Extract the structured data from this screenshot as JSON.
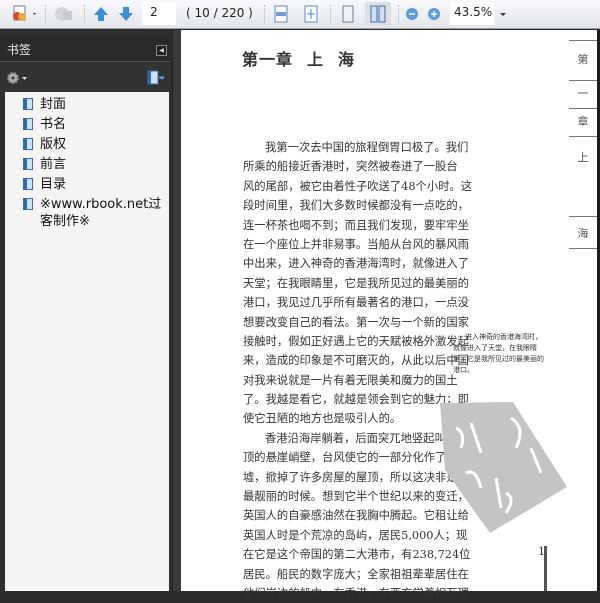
{
  "toolbar": {
    "page_number": "2",
    "page_count": "( 10 / 220 )",
    "zoom": "43.5%"
  },
  "sidebar": {
    "title": "书签",
    "bookmarks": [
      "封面",
      "书名",
      "版权",
      "前言",
      "目录",
      "※www.rbook.net过客制作※"
    ]
  },
  "document": {
    "chapter_title": [
      "第一章",
      "上",
      "海"
    ],
    "paragraphs": [
      [
        "我第一次去中国的旅程倒胃口极了。我们",
        "所乘的船接近香港时，突然被卷进了一股台",
        "风的尾部，被它由着性子吹送了48个小时。这",
        "段时间里，我们大多数时候都没有一点吃的，",
        "连一杯茶也喝不到；而且我们发现，要牢牢坐",
        "在一个座位上并非易事。当船从台风的暴风雨",
        "中出来，进入神奇的香港海湾时，就像进入了",
        "天堂；在我眼睛里，它是我所见过的最美丽的",
        "港口，我见过几乎所有最著名的港口，一点没",
        "想要改变自己的看法。第一次与一个新的国家",
        "接触时，假如正好遇上它的天赋被格外激发起",
        "来，造成的印象是不可磨灭的，从此以后中国",
        "对我来说就是一片有着无限美和魔力的国土",
        "了。我越是看它，就越是领会到它的魅力；即",
        "使它丑陋的地方也是吸引人的。"
      ],
      [
        "香港沿海岸躺着，后面突兀地竖起叫做山",
        "顶的悬崖峭壁，台风使它的一部分化作了废",
        "墟，掀掉了许多房屋的屋顶，所以这决非是它",
        "最靓丽的时候。想到它半个世纪以来的变迁，",
        "英国人的自豪感油然在我胸中腾起。它租让给",
        "英国人时是个荒凉的岛屿，居民5,000人；现",
        "在它是这个帝国的第二大港市，有238,724位",
        "居民。船民的数字庞大；全家祖祖辈辈居住在",
        "他们岸边的船中。在香港，东西方学着相互理"
      ]
    ],
    "side_note": [
      "进入神奇的香港海湾时，",
      "就像进入了天堂，在我眼睛",
      "里，它是我所见过的最美丽的",
      "港口。"
    ],
    "thumb_index": [
      "第",
      "一",
      "章",
      "上",
      "海"
    ],
    "page_footer_number": "1"
  }
}
